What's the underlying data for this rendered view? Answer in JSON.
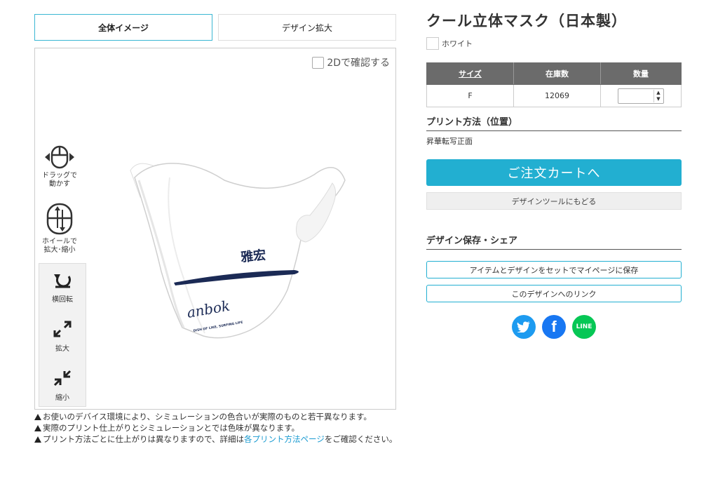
{
  "tabs": {
    "overall": "全体イメージ",
    "zoom": "デザイン拡大"
  },
  "viewer": {
    "check_2d_label": "2Dで確認する",
    "drag_hint": [
      "ドラッグで",
      "動かす"
    ],
    "wheel_hint": [
      "ホイールで",
      "拡大･縮小"
    ],
    "rotate_label": "横回転",
    "zoom_in_label": "拡大",
    "zoom_out_label": "縮小",
    "mask_print": {
      "kanji": "雅宏",
      "script": "anbok",
      "tagline": "DISH OF LIKE, SURFING LIFE"
    }
  },
  "notes": {
    "line1": "お使いのデバイス環境により、シミュレーションの色合いが実際のものと若干異なります。",
    "line2": "実際のプリント仕上がりとシミュレーションとでは色味が異なります。",
    "line3_pre": "プリント方法ごとに仕上がりは異なりますので、詳細は",
    "line3_link": "各プリント方法ページ",
    "line3_post": "をご確認ください。"
  },
  "product": {
    "title": "クール立体マスク（日本製）",
    "color_name": "ホワイト",
    "table": {
      "headers": [
        "サイズ",
        "在庫数",
        "数量"
      ],
      "rows": [
        {
          "size": "F",
          "stock": "12069",
          "qty": ""
        }
      ]
    },
    "print_method_title": "プリント方法（位置）",
    "print_method_value": "昇華転写正面",
    "cart_button": "ご注文カートへ",
    "back_button": "デザインツールにもどる",
    "save_share_title": "デザイン保存・シェア",
    "save_button": "アイテムとデザインをセットでマイページに保存",
    "link_button": "このデザインへのリンク",
    "social": {
      "line_label": "LINE",
      "facebook_glyph": "f"
    }
  },
  "colors": {
    "accent": "#22afd1",
    "twitter": "#1d9bf0",
    "facebook": "#1877f2",
    "line": "#06c755",
    "header_gray": "#6b6b6b"
  }
}
